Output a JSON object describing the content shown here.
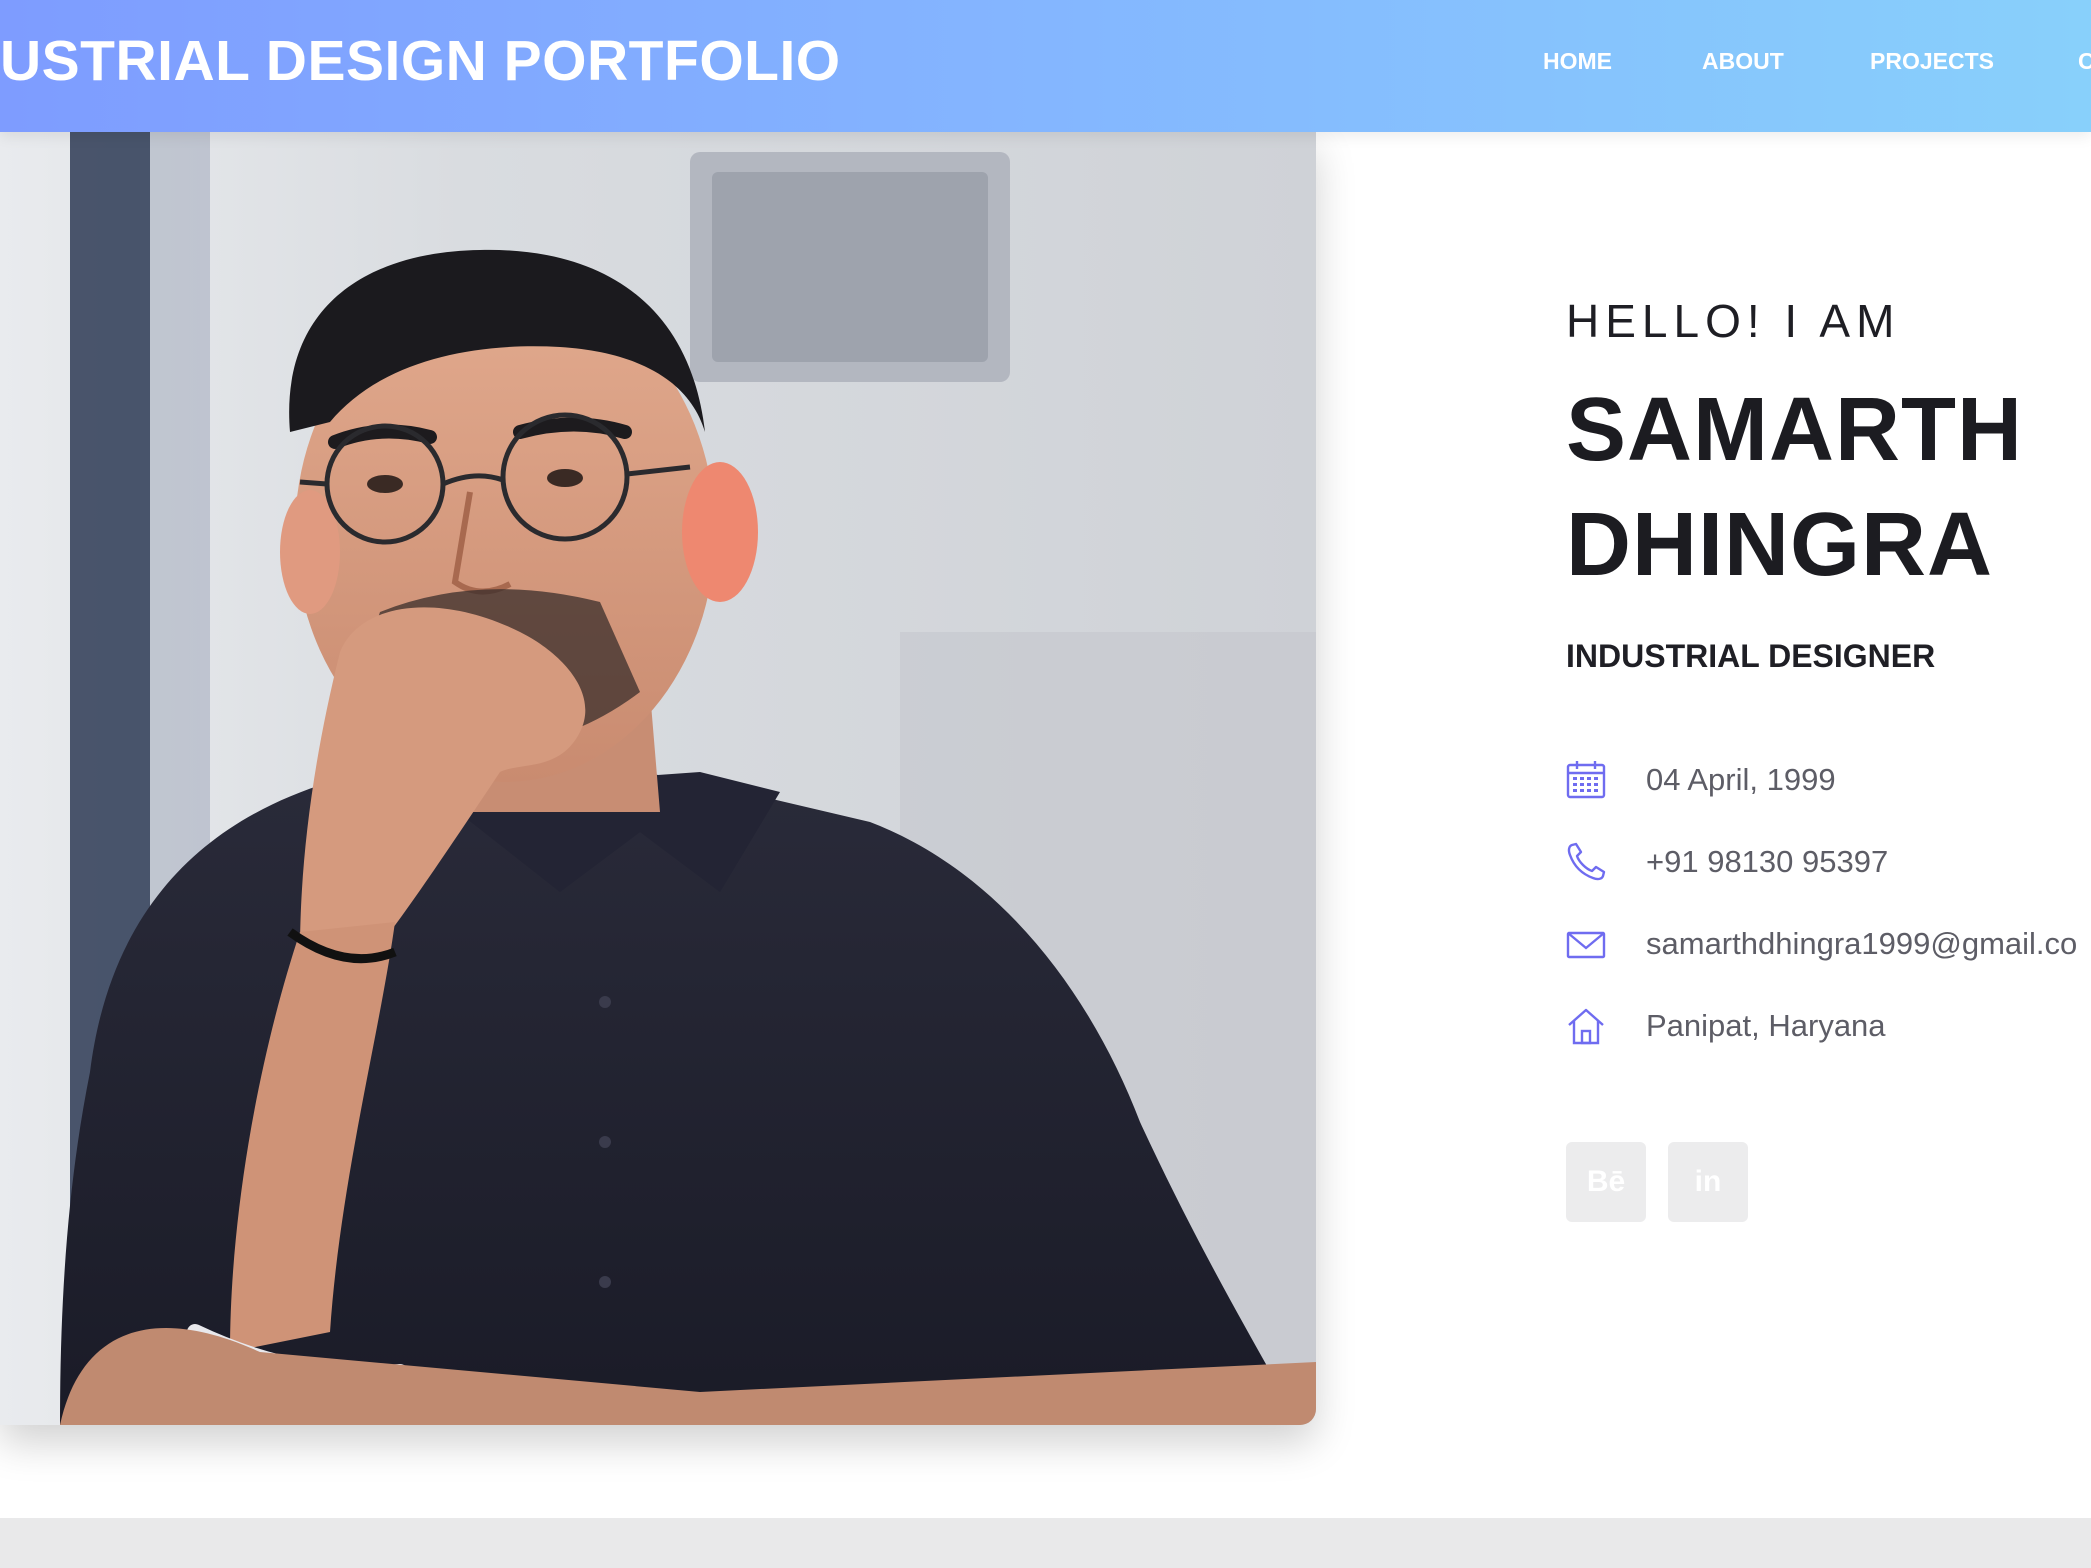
{
  "header": {
    "title": "USTRIAL DESIGN PORTFOLIO",
    "nav": [
      {
        "label": "HOME"
      },
      {
        "label": "ABOUT"
      },
      {
        "label": "PROJECTS"
      },
      {
        "label": "C"
      }
    ]
  },
  "intro": {
    "greeting": "HELLO! I AM",
    "first_name": "SAMARTH",
    "last_name": "DHINGRA",
    "role": "INDUSTRIAL DESIGNER",
    "details": [
      {
        "icon": "calendar-icon",
        "text": "04 April, 1999"
      },
      {
        "icon": "phone-icon",
        "text": "+91 98130 95397"
      },
      {
        "icon": "mail-icon",
        "text": "samarthdhingra1999@gmail.co"
      },
      {
        "icon": "home-icon",
        "text": "Panipat, Haryana"
      }
    ],
    "social": [
      {
        "icon": "behance-icon",
        "label": "Bē"
      },
      {
        "icon": "linkedin-icon",
        "label": "in"
      }
    ]
  },
  "colors": {
    "header_gradient_start": "#7e9cff",
    "header_gradient_end": "#88d0fb",
    "icon_accent": "#6f6cf0",
    "heading_text": "#1c1c21",
    "detail_text": "#5d5d66",
    "social_bg": "#ececed"
  }
}
